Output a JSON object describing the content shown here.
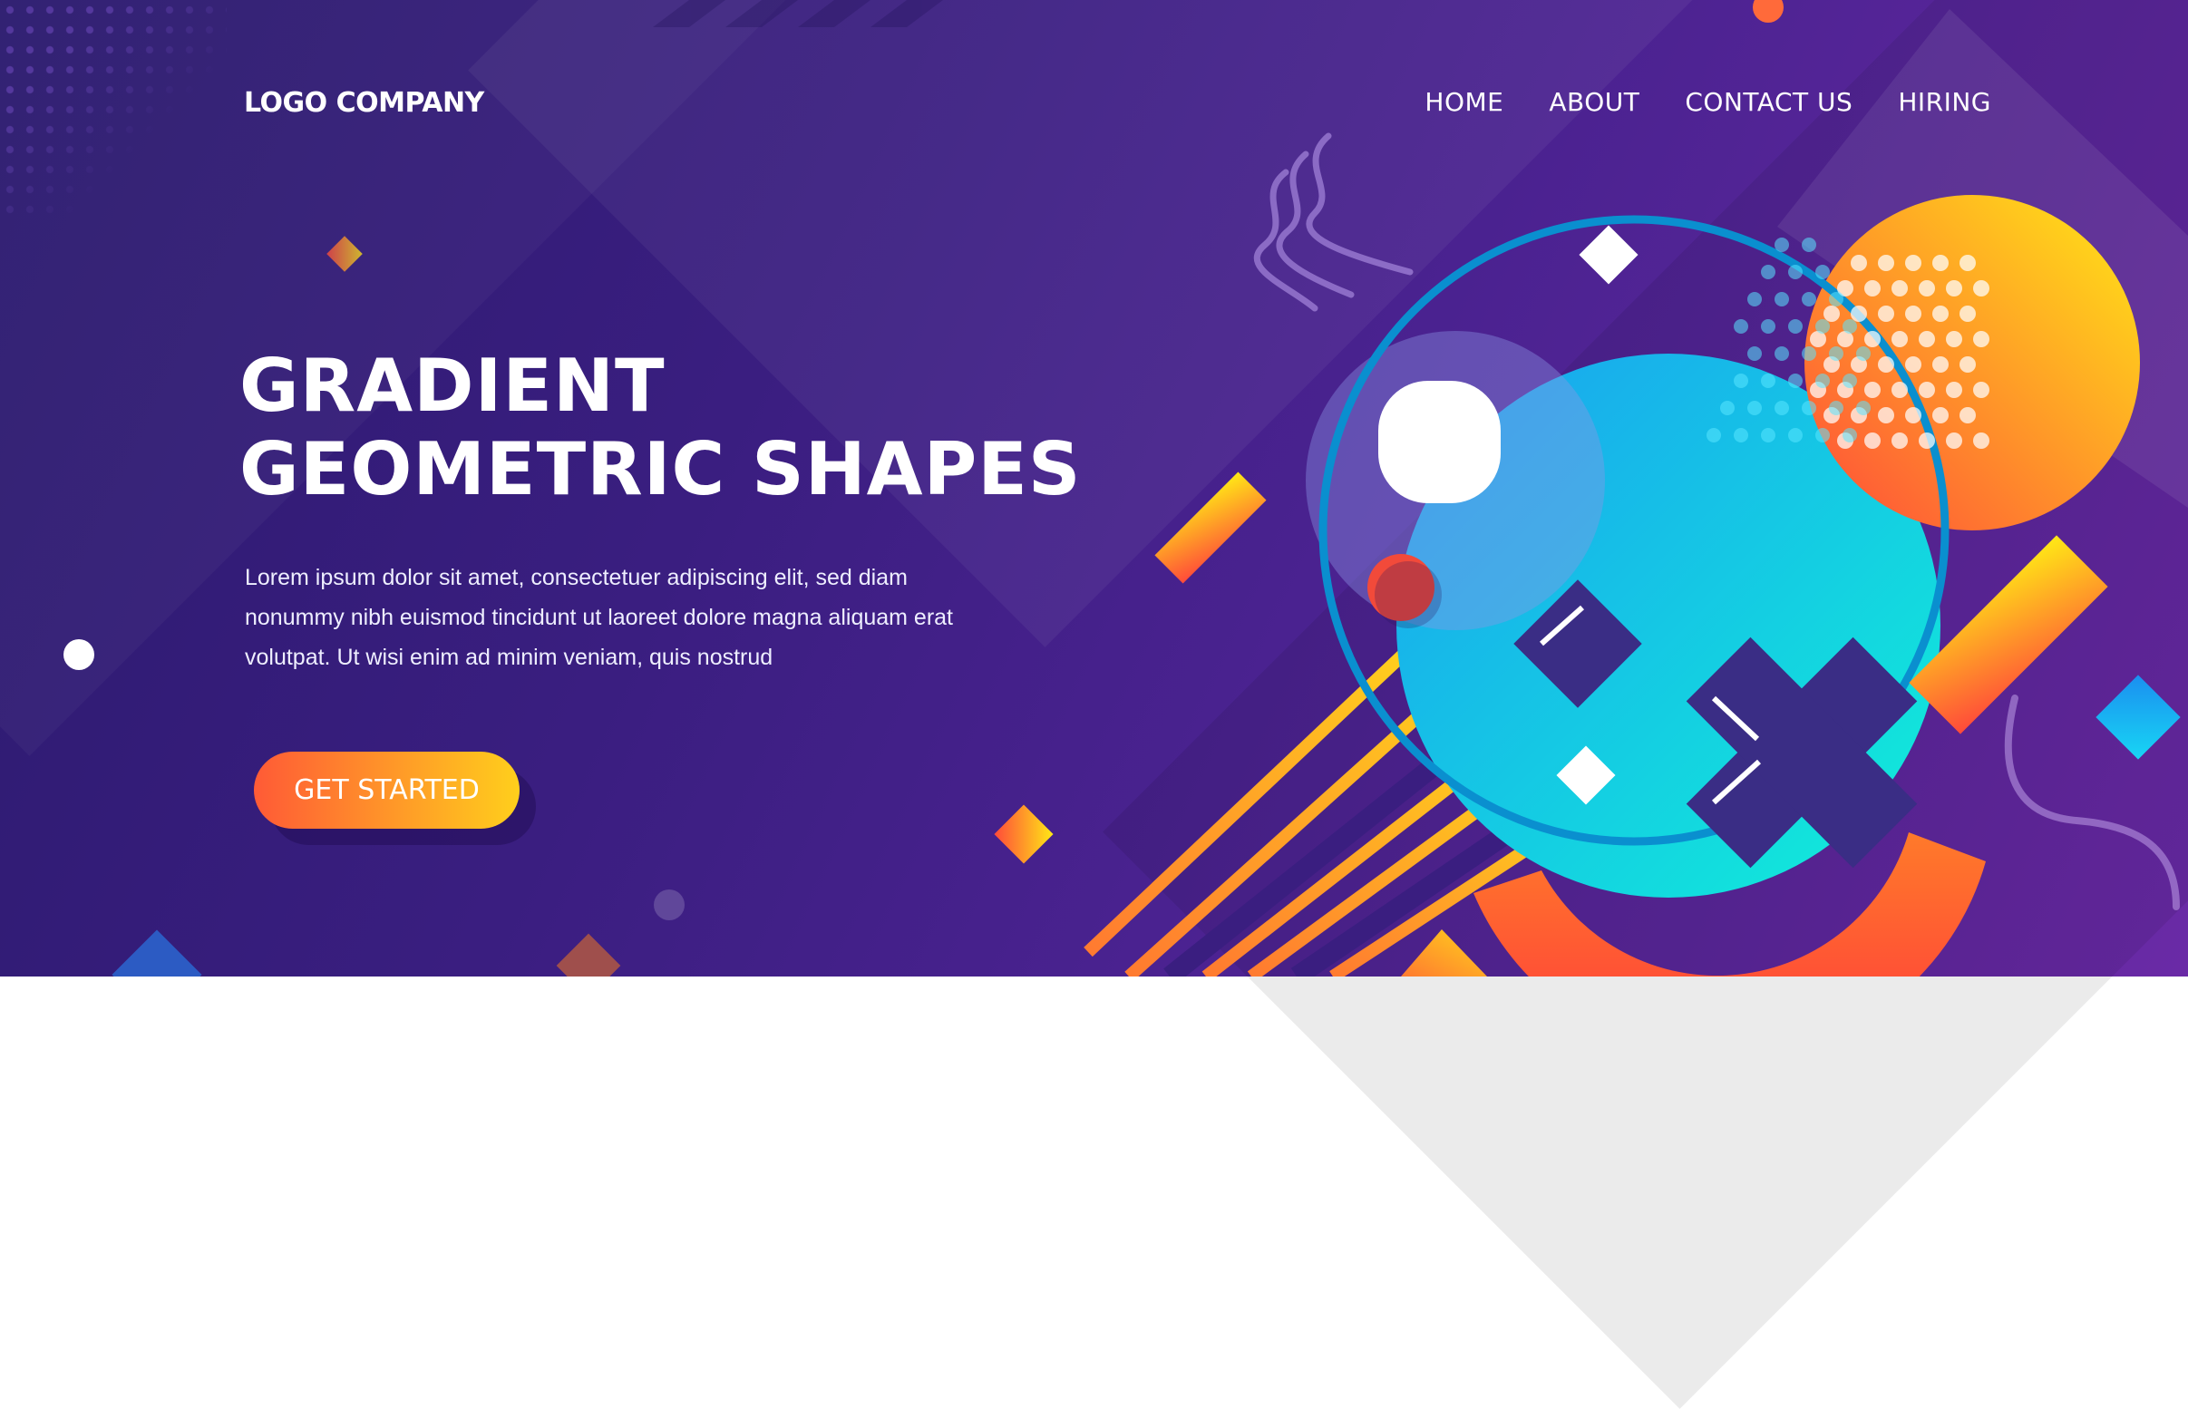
{
  "header": {
    "logo": "LOGO COMPANY",
    "nav": [
      "HOME",
      "ABOUT",
      "CONTACT US",
      "HIRING"
    ]
  },
  "hero": {
    "title_line1": "GRADIENT",
    "title_line2": "GEOMETRIC SHAPES",
    "description": "Lorem ipsum dolor sit amet, consectetuer adipiscing elit, sed diam nonummy nibh euismod tincidunt ut laoreet dolore magna aliquam erat volutpat. Ut wisi enim ad minim veniam, quis nostrud",
    "cta_label": "GET STARTED"
  },
  "colors": {
    "background_dark": "#2b1a6e",
    "background_light": "#6a2aa6",
    "accent_orange": "#ff5a36",
    "accent_yellow": "#ffcf1c",
    "accent_cyan": "#15c6f0"
  }
}
